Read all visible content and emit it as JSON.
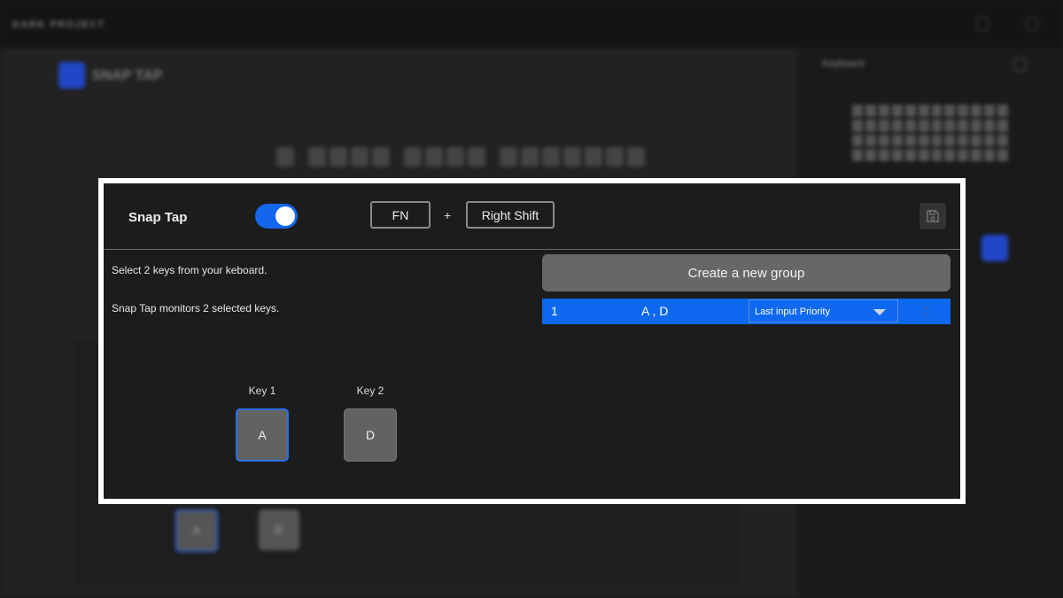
{
  "background": {
    "brand": "DARK PROJECT",
    "heading": "SNAP TAP",
    "side_title": "Keyboard",
    "key1": "A",
    "key2": "D"
  },
  "dialog": {
    "title": "Snap Tap",
    "toggle_on": true,
    "hotkey": {
      "modifier": "FN",
      "plus": "+",
      "key": "Right Shift"
    },
    "instructions": [
      "Select 2 keys from your keboard.",
      "Snap Tap monitors 2 selected keys."
    ],
    "key1": {
      "label": "Key 1",
      "value": "A"
    },
    "key2": {
      "label": "Key 2",
      "value": "D"
    },
    "create_group_label": "Create a new group",
    "groups": [
      {
        "index": "1",
        "keys": "A , D",
        "mode": "Last input Priority"
      }
    ]
  },
  "colors": {
    "accent": "#0f68f0",
    "toggle": "#1366ee",
    "selected_key_border": "#2a6ee8"
  }
}
